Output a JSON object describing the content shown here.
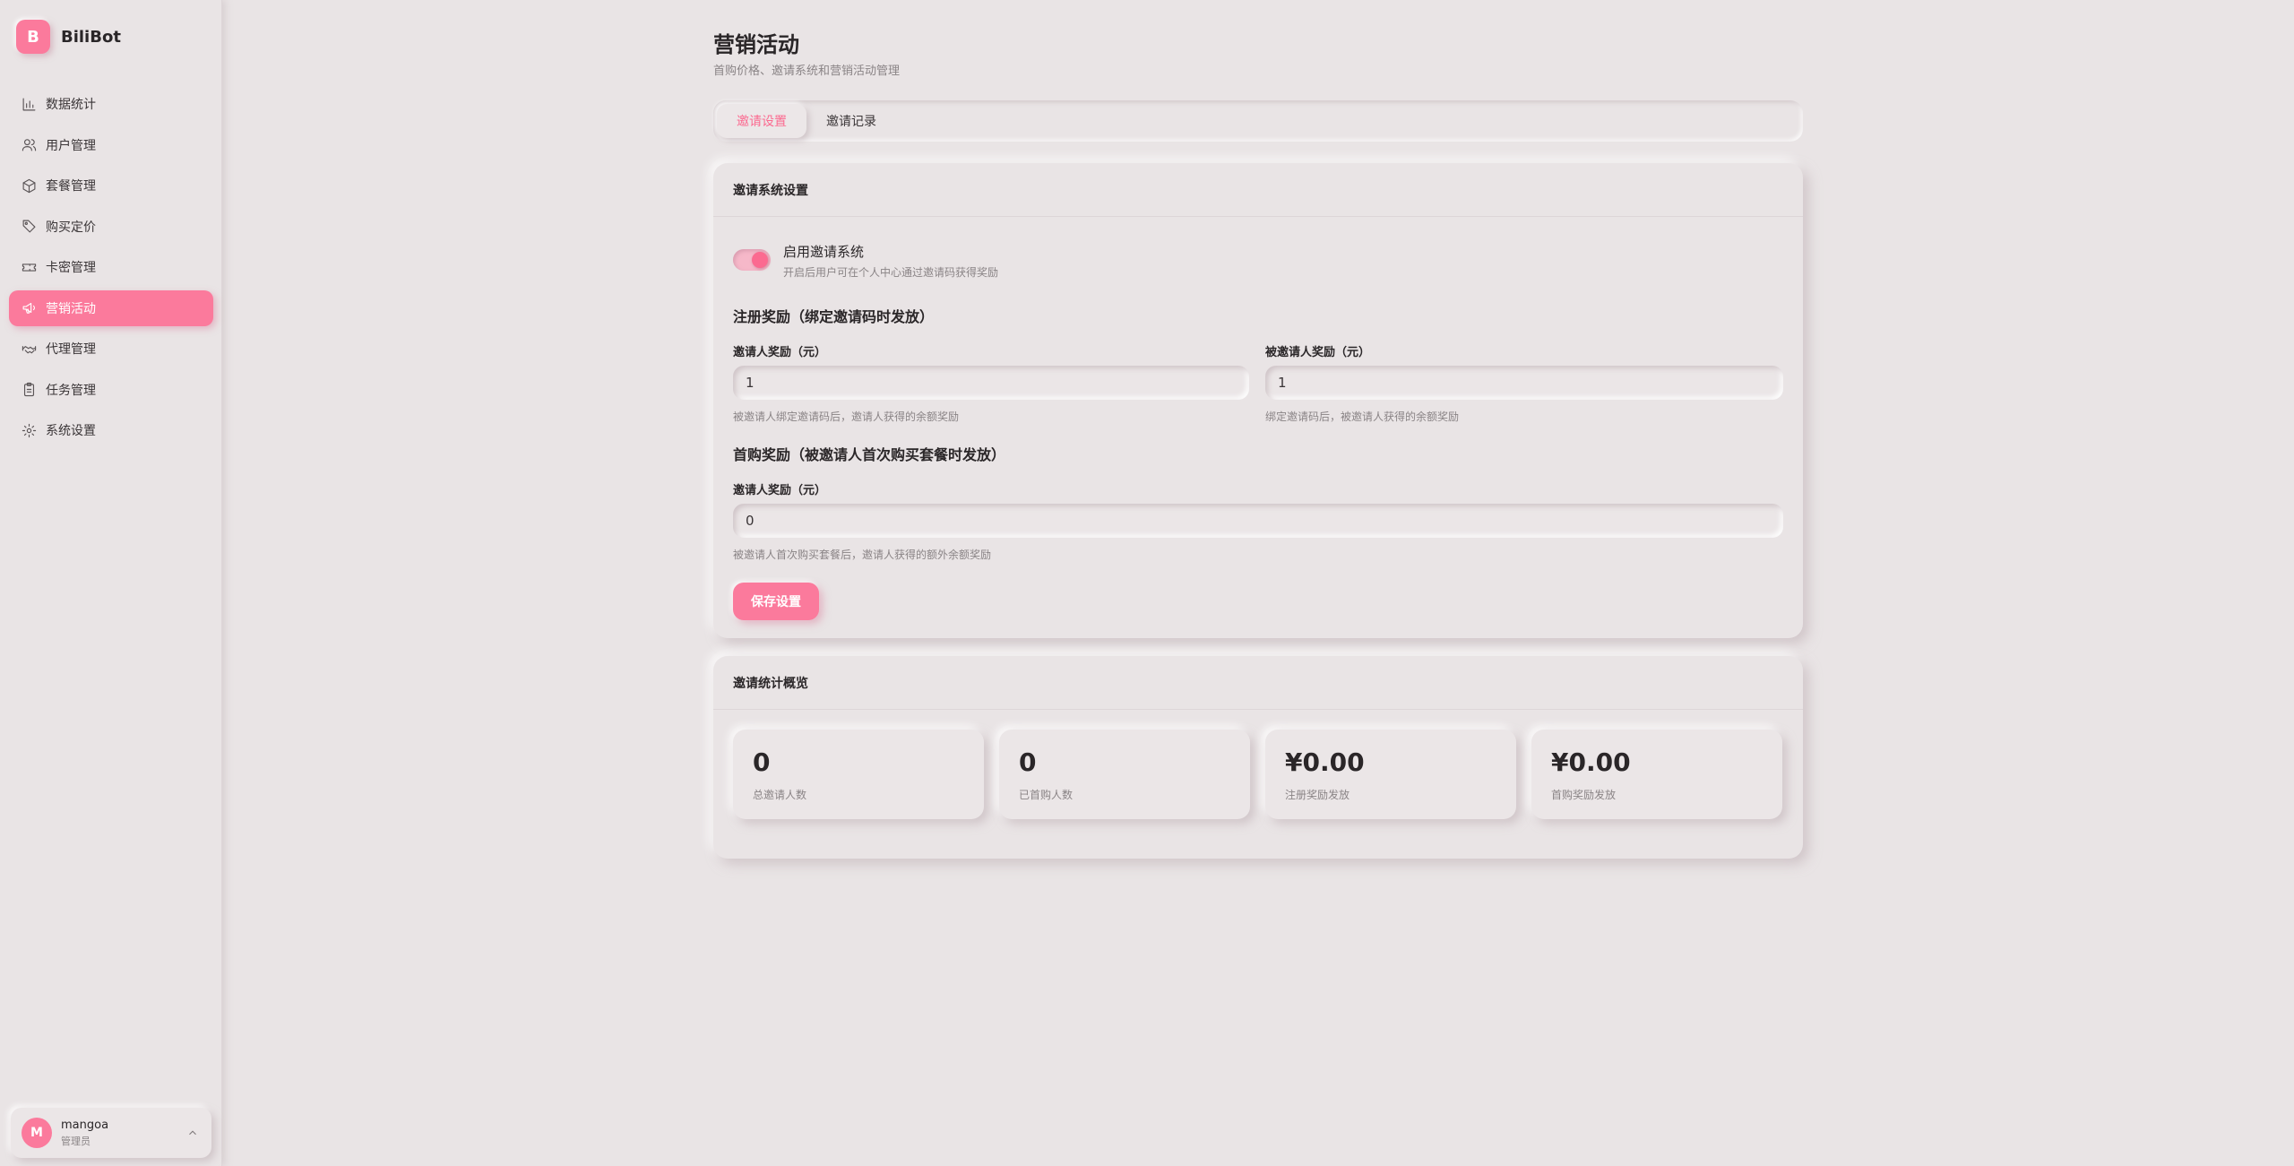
{
  "brand": {
    "logo_letter": "B",
    "name": "BiliBot",
    "accent_color": "#fb7a9c"
  },
  "sidebar": {
    "items": [
      {
        "label": "数据统计",
        "icon": "bar-chart-icon"
      },
      {
        "label": "用户管理",
        "icon": "users-icon"
      },
      {
        "label": "套餐管理",
        "icon": "package-icon"
      },
      {
        "label": "购买定价",
        "icon": "tag-icon"
      },
      {
        "label": "卡密管理",
        "icon": "ticket-icon"
      },
      {
        "label": "营销活动",
        "icon": "megaphone-icon",
        "active": true
      },
      {
        "label": "代理管理",
        "icon": "handshake-icon"
      },
      {
        "label": "任务管理",
        "icon": "clipboard-icon"
      },
      {
        "label": "系统设置",
        "icon": "gear-icon"
      }
    ]
  },
  "user": {
    "avatar_letter": "M",
    "name": "mangoa",
    "role": "管理员"
  },
  "page": {
    "title": "营销活动",
    "subtitle": "首购价格、邀请系统和营销活动管理"
  },
  "tabs": [
    {
      "label": "邀请设置",
      "active": true
    },
    {
      "label": "邀请记录",
      "active": false
    }
  ],
  "settings": {
    "header": "邀请系统设置",
    "toggle": {
      "label": "启用邀请系统",
      "help": "开启后用户可在个人中心通过邀请码获得奖励",
      "enabled": true
    },
    "register_section": {
      "title": "注册奖励（绑定邀请码时发放）",
      "inviter": {
        "label": "邀请人奖励（元）",
        "value": "1",
        "help": "被邀请人绑定邀请码后，邀请人获得的余额奖励"
      },
      "invitee": {
        "label": "被邀请人奖励（元）",
        "value": "1",
        "help": "绑定邀请码后，被邀请人获得的余额奖励"
      }
    },
    "first_purchase_section": {
      "title": "首购奖励（被邀请人首次购买套餐时发放）",
      "inviter": {
        "label": "邀请人奖励（元）",
        "value": "0",
        "help": "被邀请人首次购买套餐后，邀请人获得的额外余额奖励"
      }
    },
    "save_label": "保存设置"
  },
  "stats": {
    "header": "邀请统计概览",
    "items": [
      {
        "value": "0",
        "label": "总邀请人数"
      },
      {
        "value": "0",
        "label": "已首购人数"
      },
      {
        "value": "¥0.00",
        "label": "注册奖励发放"
      },
      {
        "value": "¥0.00",
        "label": "首购奖励发放"
      }
    ]
  }
}
